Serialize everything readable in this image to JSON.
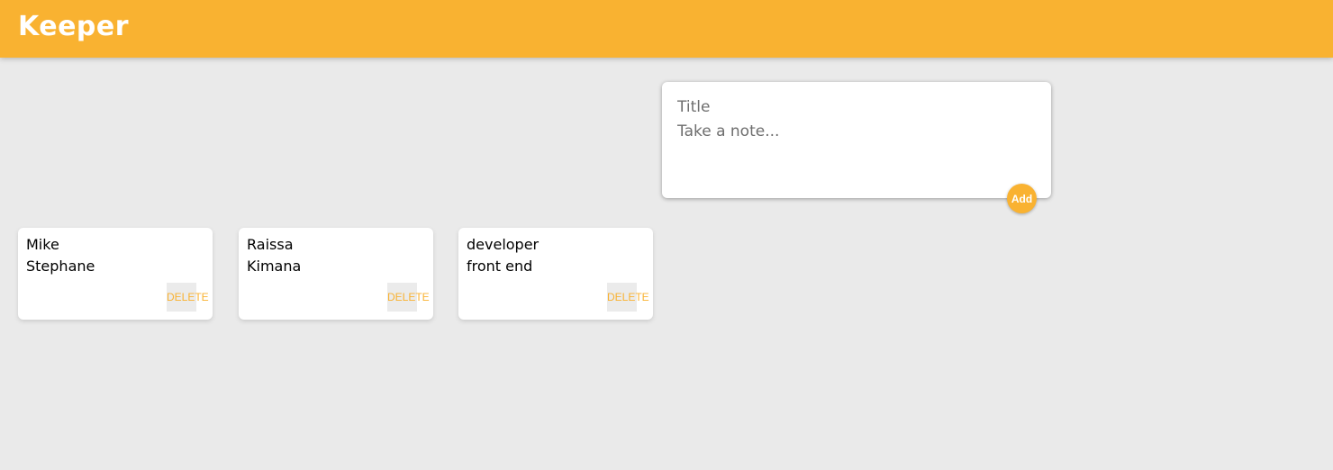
{
  "header": {
    "app_title": "Keeper",
    "background_color": "#f9b231"
  },
  "create_note": {
    "title_placeholder": "Title",
    "content_placeholder": "Take a note...",
    "add_label": "Add"
  },
  "notes": [
    {
      "title": "Mike",
      "content": "Stephane",
      "delete_label": "DELETE"
    },
    {
      "title": "Raissa",
      "content": "Kimana",
      "delete_label": "DELETE"
    },
    {
      "title": "developer",
      "content": "front end",
      "delete_label": "DELETE"
    }
  ],
  "colors": {
    "accent": "#f9b231",
    "page_background": "#eaeaea",
    "card_background": "#ffffff"
  }
}
